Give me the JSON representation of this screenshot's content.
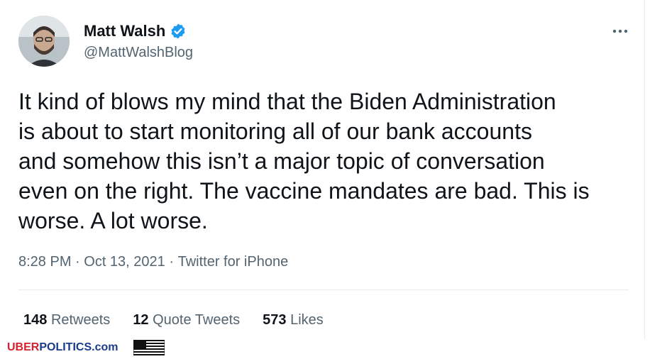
{
  "author": {
    "display_name": "Matt Walsh",
    "handle": "@MattWalshBlog",
    "verified_icon": "verified-badge-icon",
    "avatar_icon": "profile-photo"
  },
  "tweet": {
    "text": "It kind of blows my mind that the Biden Administration\nis about to start monitoring all of our bank accounts\nand somehow this isn’t a major topic of conversation\neven on the right. The vaccine mandates are bad. This is\nworse. A lot worse.",
    "time": "8:28 PM",
    "separator": " · ",
    "date": "Oct 13, 2021",
    "source": "Twitter for iPhone"
  },
  "stats": {
    "retweets_count": "148",
    "retweets_label": "Retweets",
    "quote_count": "12",
    "quote_label": "Quote Tweets",
    "likes_count": "573",
    "likes_label": "Likes"
  },
  "watermark": {
    "part1": "UBER",
    "part2": "POLITICS.com"
  },
  "colors": {
    "accent": "#1d9bf0",
    "text_primary": "#0f1419",
    "text_secondary": "#536471",
    "brand_red": "#d4212d",
    "brand_blue": "#1a3a8c"
  }
}
